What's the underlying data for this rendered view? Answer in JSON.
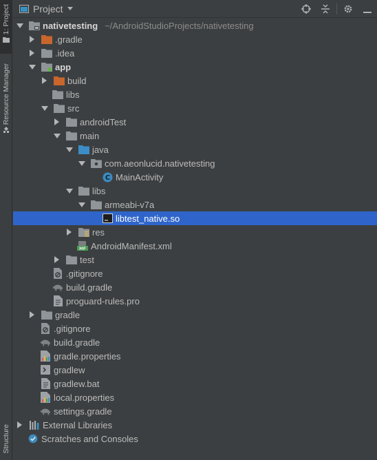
{
  "window": {
    "header_title": "Project",
    "tools": [
      "locate-icon",
      "collapse-all-icon",
      "settings-icon",
      "hide-icon"
    ]
  },
  "strip": {
    "project_tab": "1: Project",
    "resource_tab": "Resource Manager",
    "structure_tab": "Structure"
  },
  "tree": [
    {
      "label": "nativetesting",
      "path": "~/AndroidStudioProjects/nativetesting",
      "depth": 0,
      "state": "open",
      "icon": "project-module-icon",
      "bold": true
    },
    {
      "label": ".gradle",
      "depth": 1,
      "state": "closed",
      "icon": "folder-orange-icon"
    },
    {
      "label": ".idea",
      "depth": 1,
      "state": "closed",
      "icon": "folder-icon"
    },
    {
      "label": "app",
      "depth": 1,
      "state": "open",
      "icon": "android-module-icon",
      "bold": true
    },
    {
      "label": "build",
      "depth": 2,
      "state": "closed",
      "icon": "folder-orange-icon"
    },
    {
      "label": "libs",
      "depth": 2,
      "state": "leaf",
      "icon": "folder-icon"
    },
    {
      "label": "src",
      "depth": 2,
      "state": "open",
      "icon": "folder-icon"
    },
    {
      "label": "androidTest",
      "depth": 3,
      "state": "closed",
      "icon": "folder-icon"
    },
    {
      "label": "main",
      "depth": 3,
      "state": "open",
      "icon": "folder-icon"
    },
    {
      "label": "java",
      "depth": 4,
      "state": "open",
      "icon": "folder-blue-icon"
    },
    {
      "label": "com.aeonlucid.nativetesting",
      "depth": 5,
      "state": "open",
      "icon": "package-icon"
    },
    {
      "label": "MainActivity",
      "depth": 6,
      "state": "leaf",
      "icon": "class-c-icon"
    },
    {
      "label": "libs",
      "depth": 4,
      "state": "open",
      "icon": "folder-icon"
    },
    {
      "label": "armeabi-v7a",
      "depth": 5,
      "state": "open",
      "icon": "folder-icon"
    },
    {
      "label": "libtest_native.so",
      "depth": 6,
      "state": "leaf",
      "icon": "binary-file-icon",
      "selected": true
    },
    {
      "label": "res",
      "depth": 4,
      "state": "closed",
      "icon": "folder-res-icon"
    },
    {
      "label": "AndroidManifest.xml",
      "depth": 4,
      "state": "leaf",
      "icon": "manifest-icon"
    },
    {
      "label": "test",
      "depth": 3,
      "state": "closed",
      "icon": "folder-icon"
    },
    {
      "label": ".gitignore",
      "depth": 2,
      "state": "leaf",
      "icon": "gitignore-icon"
    },
    {
      "label": "build.gradle",
      "depth": 2,
      "state": "leaf",
      "icon": "gradle-elephant-icon"
    },
    {
      "label": "proguard-rules.pro",
      "depth": 2,
      "state": "leaf",
      "icon": "text-file-icon"
    },
    {
      "label": "gradle",
      "depth": 1,
      "state": "closed",
      "icon": "folder-icon"
    },
    {
      "label": ".gitignore",
      "depth": 1,
      "state": "leaf",
      "icon": "gitignore-icon"
    },
    {
      "label": "build.gradle",
      "depth": 1,
      "state": "leaf",
      "icon": "gradle-elephant-icon"
    },
    {
      "label": "gradle.properties",
      "depth": 1,
      "state": "leaf",
      "icon": "properties-icon"
    },
    {
      "label": "gradlew",
      "depth": 1,
      "state": "leaf",
      "icon": "shell-script-icon"
    },
    {
      "label": "gradlew.bat",
      "depth": 1,
      "state": "leaf",
      "icon": "text-file-icon"
    },
    {
      "label": "local.properties",
      "depth": 1,
      "state": "leaf",
      "icon": "properties-icon"
    },
    {
      "label": "settings.gradle",
      "depth": 1,
      "state": "leaf",
      "icon": "gradle-elephant-icon"
    },
    {
      "label": "External Libraries",
      "depth": 0,
      "state": "closed",
      "icon": "libraries-icon"
    },
    {
      "label": "Scratches and Consoles",
      "depth": 0,
      "state": "leaf",
      "icon": "scratches-icon"
    }
  ],
  "colors": {
    "background": "#3c3f41",
    "selection": "#2f65ca",
    "folder": "#8f9599",
    "folder_orange": "#c8662d",
    "folder_blue": "#3c8dc7",
    "android_green": "#62b543"
  }
}
